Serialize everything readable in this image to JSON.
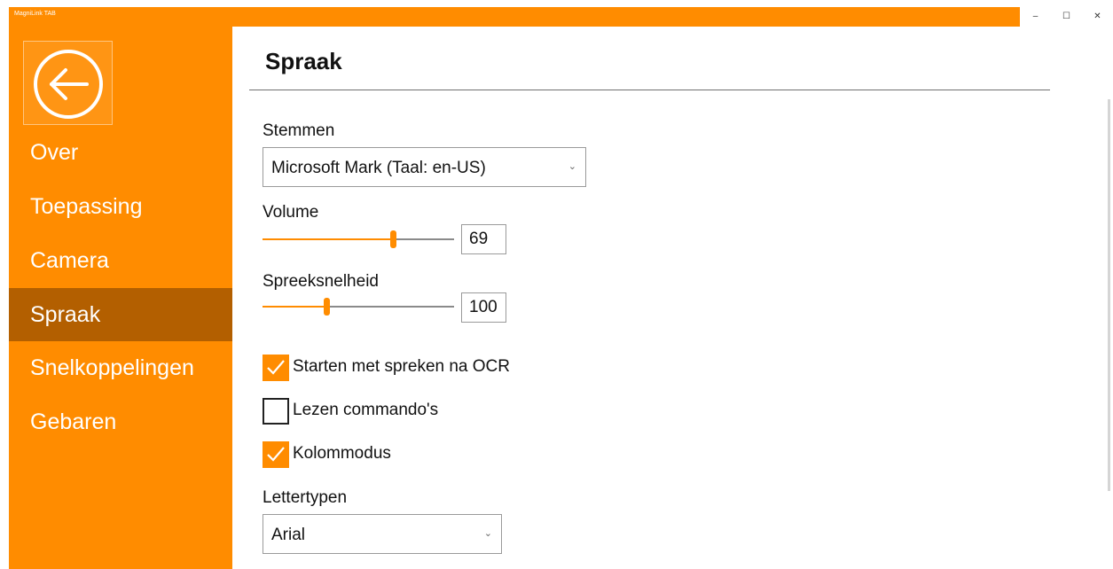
{
  "window": {
    "title": "MagniLink TAB",
    "controls": {
      "minimize": "–",
      "maximize": "☐",
      "close": "✕"
    },
    "accent_color": "#ff8c00",
    "active_color": "#b35f00"
  },
  "sidebar": {
    "back_icon": "back-arrow-icon",
    "items": [
      {
        "label": "Over",
        "active": false
      },
      {
        "label": "Toepassing",
        "active": false
      },
      {
        "label": "Camera",
        "active": false
      },
      {
        "label": "Spraak",
        "active": true
      },
      {
        "label": "Snelkoppelingen",
        "active": false
      },
      {
        "label": "Gebaren",
        "active": false
      }
    ]
  },
  "main": {
    "title": "Spraak",
    "voices": {
      "label": "Stemmen",
      "value": "Microsoft Mark (Taal: en-US)"
    },
    "volume": {
      "label": "Volume",
      "value": "69",
      "fraction": 0.69
    },
    "speed": {
      "label": "Spreeksnelheid",
      "value": "100",
      "fraction": 0.33
    },
    "checkboxes": [
      {
        "label": "Starten met spreken na OCR",
        "checked": true
      },
      {
        "label": "Lezen commando's",
        "checked": false
      },
      {
        "label": "Kolommodus",
        "checked": true
      }
    ],
    "fonts": {
      "label": "Lettertypen",
      "value": "Arial"
    }
  }
}
